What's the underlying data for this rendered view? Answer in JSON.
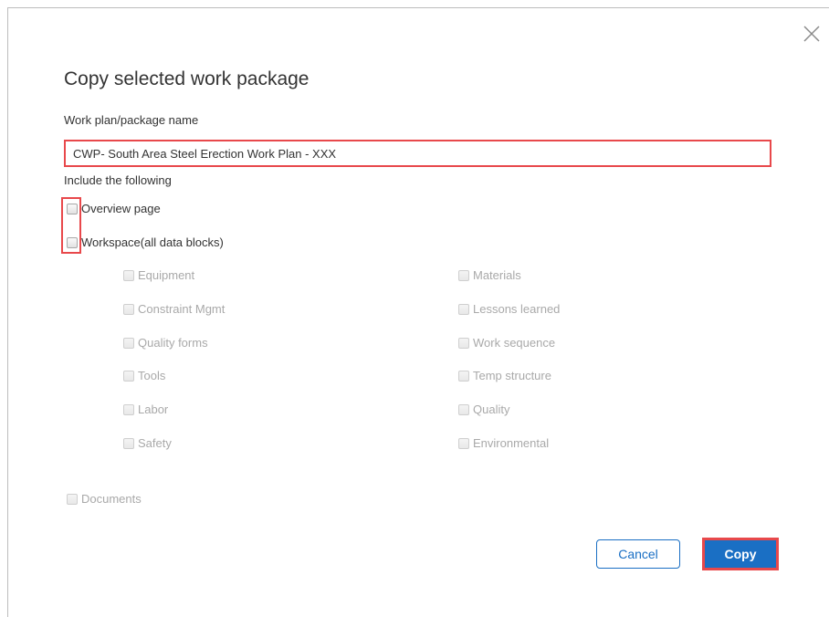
{
  "dialog": {
    "title": "Copy selected work package",
    "name_label": "Work plan/package name",
    "name_value": "CWP- South Area Steel Erection Work Plan - XXX",
    "include_label": "Include the following"
  },
  "options": {
    "overview": "Overview page",
    "workspace": "Workspace(all data blocks)",
    "documents": "Documents"
  },
  "data_blocks": {
    "left": [
      "Equipment",
      "Constraint Mgmt",
      "Quality forms",
      "Tools",
      "Labor",
      "Safety"
    ],
    "right": [
      "Materials",
      "Lessons learned",
      "Work sequence",
      "Temp structure",
      "Quality",
      "Environmental"
    ]
  },
  "buttons": {
    "cancel": "Cancel",
    "copy": "Copy"
  },
  "colors": {
    "primary": "#1a6fc4",
    "highlight": "#e8484b",
    "disabled_text": "#a9a9a9"
  },
  "icons": {
    "close": "close-icon"
  }
}
